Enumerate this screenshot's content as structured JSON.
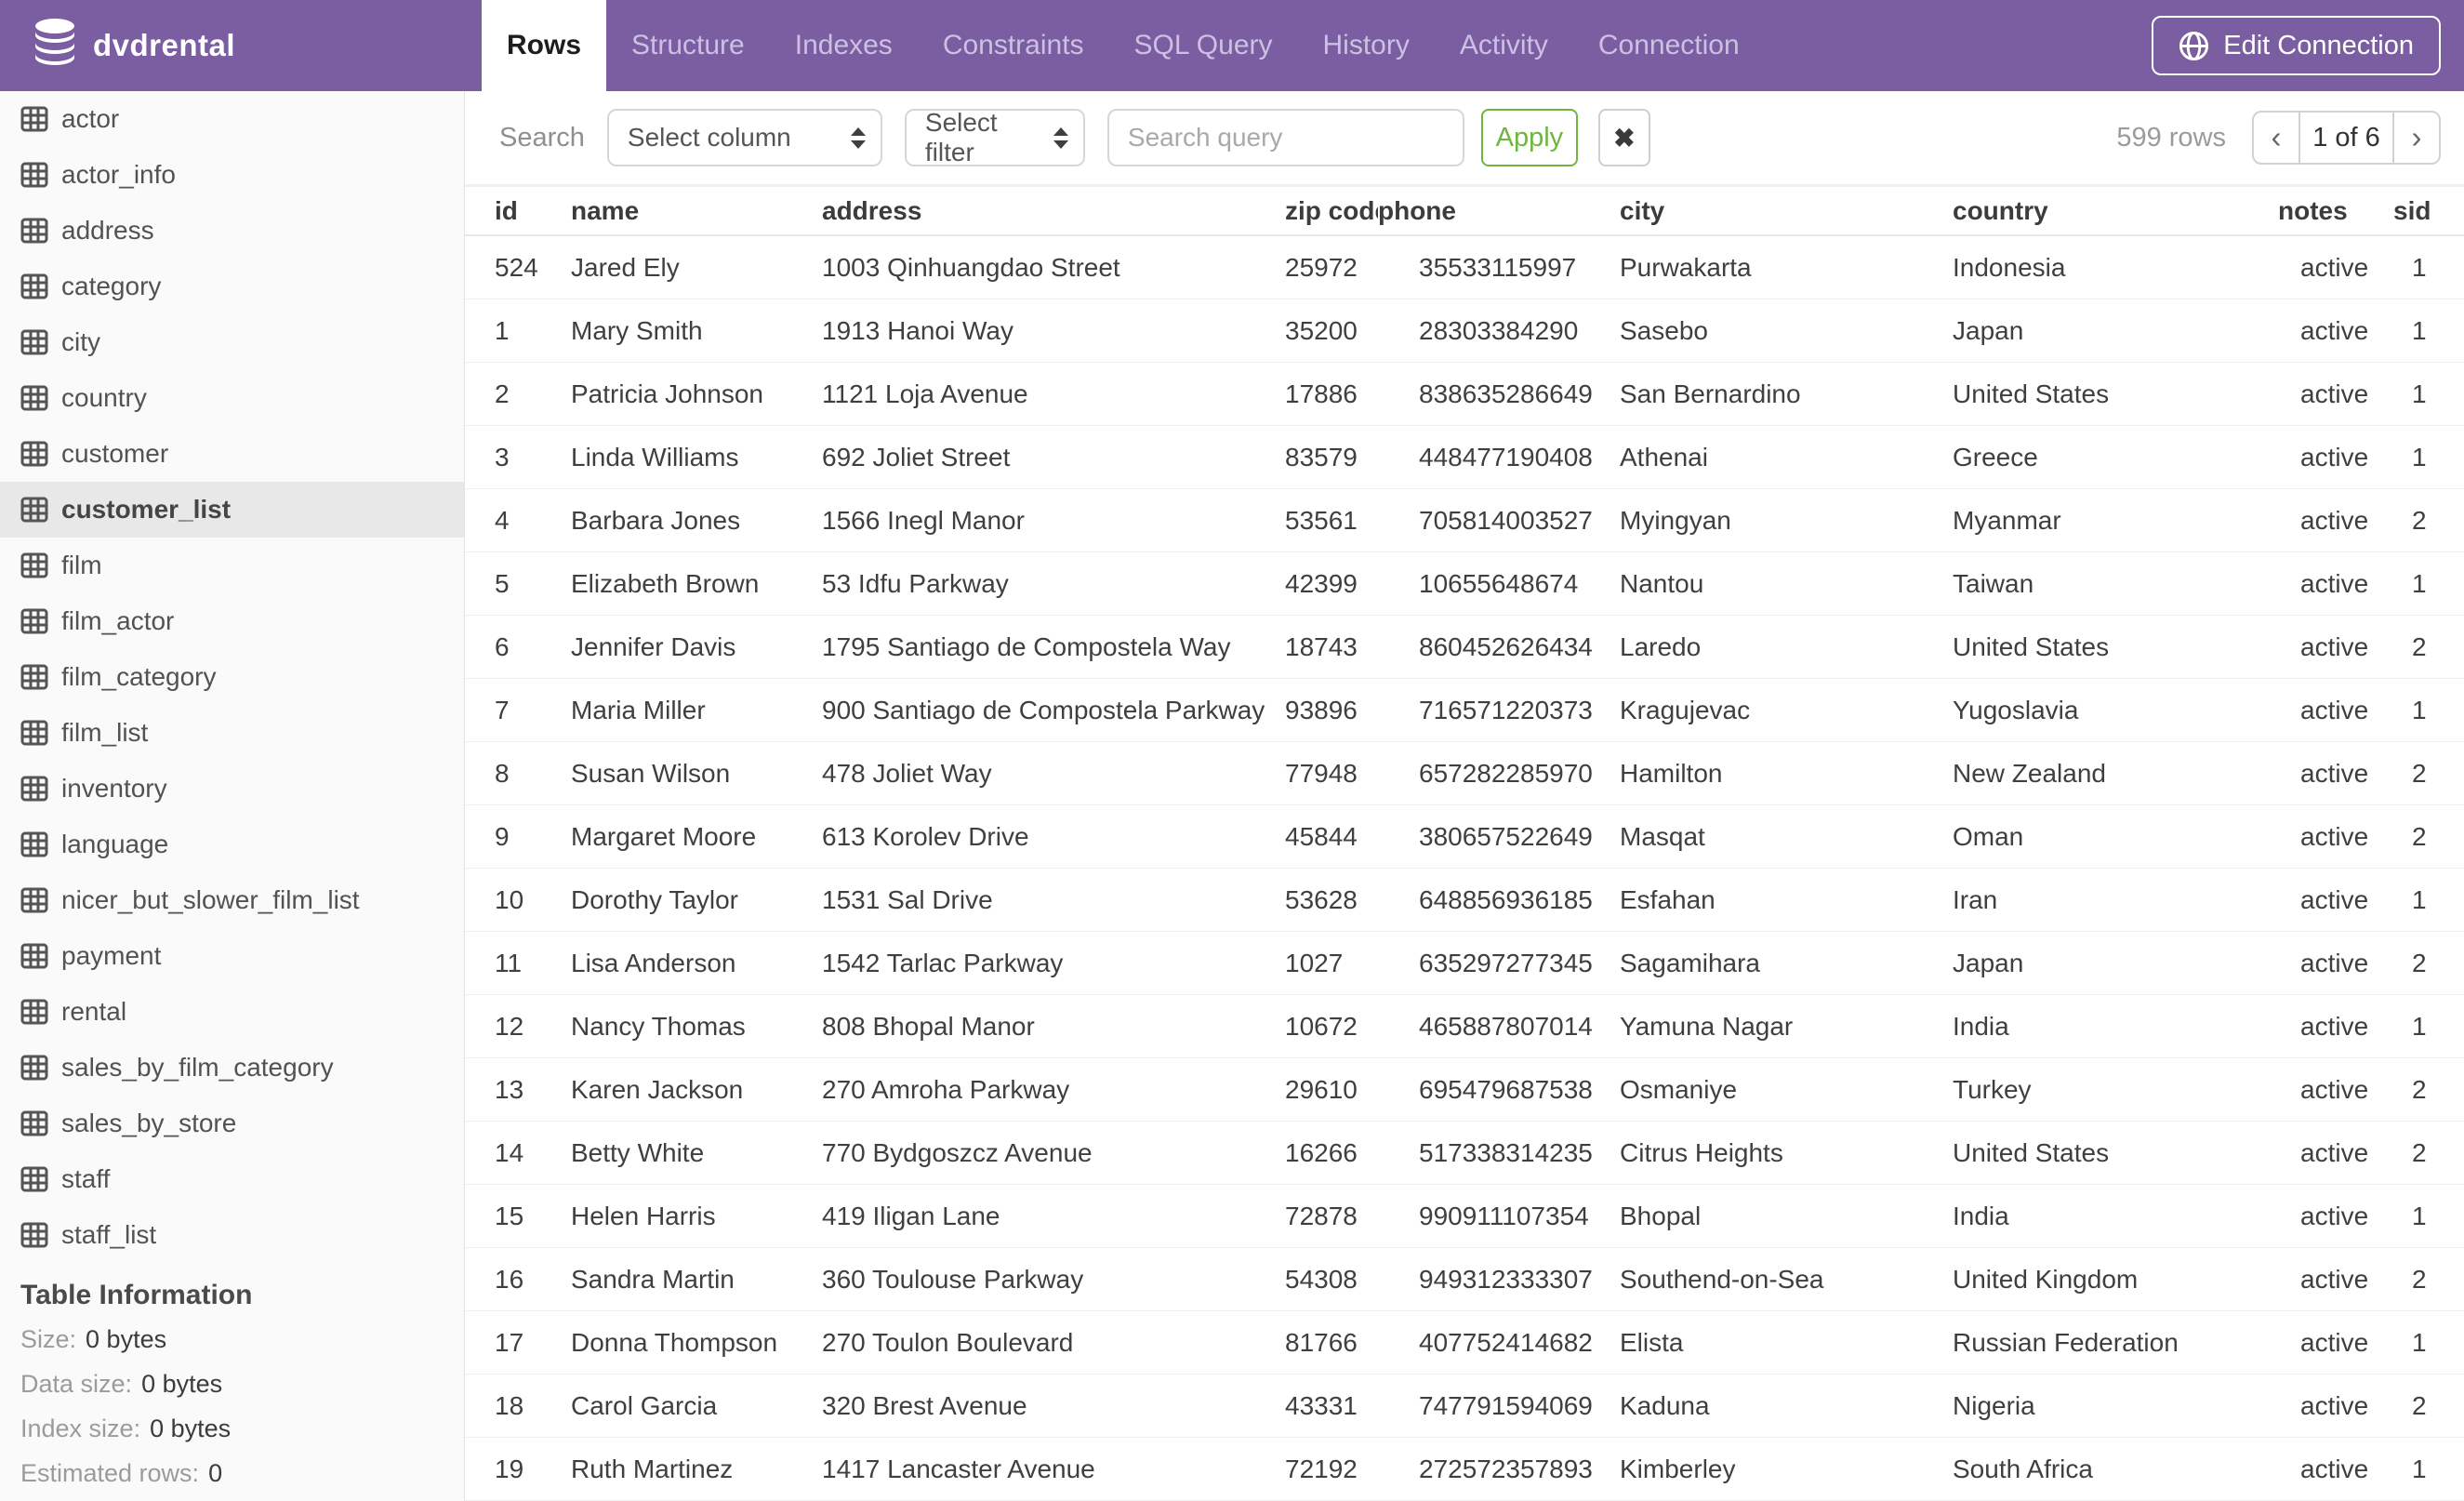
{
  "app": {
    "database_name": "dvdrental",
    "colors": {
      "header_bg": "#7B5DA1",
      "accent_green": "#6FB53F",
      "selected_item_bg": "#E8E8E8"
    }
  },
  "header": {
    "tabs": [
      {
        "label": "Rows",
        "active": true
      },
      {
        "label": "Structure"
      },
      {
        "label": "Indexes"
      },
      {
        "label": "Constraints"
      },
      {
        "label": "SQL Query"
      },
      {
        "label": "History"
      },
      {
        "label": "Activity"
      },
      {
        "label": "Connection"
      }
    ],
    "edit_connection_label": "Edit Connection"
  },
  "icons": {
    "logo": "database-cylinder",
    "sidebar_table": "table-grid",
    "edit_connection": "globe",
    "clear_filter": "✖",
    "prev": "‹",
    "next": "›",
    "select_arrows": "up-down-triangles"
  },
  "sidebar": {
    "tables": [
      {
        "name": "actor"
      },
      {
        "name": "actor_info"
      },
      {
        "name": "address"
      },
      {
        "name": "category"
      },
      {
        "name": "city"
      },
      {
        "name": "country"
      },
      {
        "name": "customer"
      },
      {
        "name": "customer_list",
        "selected": true
      },
      {
        "name": "film"
      },
      {
        "name": "film_actor"
      },
      {
        "name": "film_category"
      },
      {
        "name": "film_list"
      },
      {
        "name": "inventory"
      },
      {
        "name": "language"
      },
      {
        "name": "nicer_but_slower_film_list"
      },
      {
        "name": "payment"
      },
      {
        "name": "rental"
      },
      {
        "name": "sales_by_film_category"
      },
      {
        "name": "sales_by_store"
      },
      {
        "name": "staff"
      },
      {
        "name": "staff_list"
      }
    ],
    "table_information": {
      "title": "Table Information",
      "fields": [
        {
          "label": "Size:",
          "value": "0 bytes"
        },
        {
          "label": "Data size:",
          "value": "0 bytes"
        },
        {
          "label": "Index size:",
          "value": "0 bytes"
        },
        {
          "label": "Estimated rows:",
          "value": "0"
        }
      ]
    }
  },
  "toolbar": {
    "search_label": "Search",
    "column_select_value": "Select column",
    "filter_select_value": "Select filter",
    "query_placeholder": "Search query",
    "apply_label": "Apply",
    "rows_count": "599 rows",
    "page_indicator": "1 of 6"
  },
  "table": {
    "columns": [
      "id",
      "name",
      "address",
      "zip code",
      "phone",
      "city",
      "country",
      "notes",
      "sid"
    ],
    "rows": [
      [
        "524",
        "Jared Ely",
        "1003 Qinhuangdao Street",
        "25972",
        "35533115997",
        "Purwakarta",
        "Indonesia",
        "active",
        "1"
      ],
      [
        "1",
        "Mary Smith",
        "1913 Hanoi Way",
        "35200",
        "28303384290",
        "Sasebo",
        "Japan",
        "active",
        "1"
      ],
      [
        "2",
        "Patricia Johnson",
        "1121 Loja Avenue",
        "17886",
        "838635286649",
        "San Bernardino",
        "United States",
        "active",
        "1"
      ],
      [
        "3",
        "Linda Williams",
        "692 Joliet Street",
        "83579",
        "448477190408",
        "Athenai",
        "Greece",
        "active",
        "1"
      ],
      [
        "4",
        "Barbara Jones",
        "1566 Inegl Manor",
        "53561",
        "705814003527",
        "Myingyan",
        "Myanmar",
        "active",
        "2"
      ],
      [
        "5",
        "Elizabeth Brown",
        "53 Idfu Parkway",
        "42399",
        "10655648674",
        "Nantou",
        "Taiwan",
        "active",
        "1"
      ],
      [
        "6",
        "Jennifer Davis",
        "1795 Santiago de Compostela Way",
        "18743",
        "860452626434",
        "Laredo",
        "United States",
        "active",
        "2"
      ],
      [
        "7",
        "Maria Miller",
        "900 Santiago de Compostela Parkway",
        "93896",
        "716571220373",
        "Kragujevac",
        "Yugoslavia",
        "active",
        "1"
      ],
      [
        "8",
        "Susan Wilson",
        "478 Joliet Way",
        "77948",
        "657282285970",
        "Hamilton",
        "New Zealand",
        "active",
        "2"
      ],
      [
        "9",
        "Margaret Moore",
        "613 Korolev Drive",
        "45844",
        "380657522649",
        "Masqat",
        "Oman",
        "active",
        "2"
      ],
      [
        "10",
        "Dorothy Taylor",
        "1531 Sal Drive",
        "53628",
        "648856936185",
        "Esfahan",
        "Iran",
        "active",
        "1"
      ],
      [
        "11",
        "Lisa Anderson",
        "1542 Tarlac Parkway",
        "1027",
        "635297277345",
        "Sagamihara",
        "Japan",
        "active",
        "2"
      ],
      [
        "12",
        "Nancy Thomas",
        "808 Bhopal Manor",
        "10672",
        "465887807014",
        "Yamuna Nagar",
        "India",
        "active",
        "1"
      ],
      [
        "13",
        "Karen Jackson",
        "270 Amroha Parkway",
        "29610",
        "695479687538",
        "Osmaniye",
        "Turkey",
        "active",
        "2"
      ],
      [
        "14",
        "Betty White",
        "770 Bydgoszcz Avenue",
        "16266",
        "517338314235",
        "Citrus Heights",
        "United States",
        "active",
        "2"
      ],
      [
        "15",
        "Helen Harris",
        "419 Iligan Lane",
        "72878",
        "990911107354",
        "Bhopal",
        "India",
        "active",
        "1"
      ],
      [
        "16",
        "Sandra Martin",
        "360 Toulouse Parkway",
        "54308",
        "949312333307",
        "Southend-on-Sea",
        "United Kingdom",
        "active",
        "2"
      ],
      [
        "17",
        "Donna Thompson",
        "270 Toulon Boulevard",
        "81766",
        "407752414682",
        "Elista",
        "Russian Federation",
        "active",
        "1"
      ],
      [
        "18",
        "Carol Garcia",
        "320 Brest Avenue",
        "43331",
        "747791594069",
        "Kaduna",
        "Nigeria",
        "active",
        "2"
      ],
      [
        "19",
        "Ruth Martinez",
        "1417 Lancaster Avenue",
        "72192",
        "272572357893",
        "Kimberley",
        "South Africa",
        "active",
        "1"
      ]
    ]
  }
}
